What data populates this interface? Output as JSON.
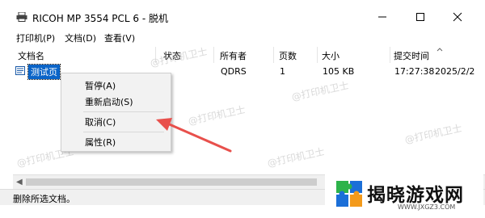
{
  "window": {
    "title": "RICOH MP 3554 PCL 6 - 脱机",
    "minimize_icon": "minimize-icon",
    "maximize_icon": "maximize-icon",
    "close_icon": "close-icon"
  },
  "menu": {
    "items": [
      "打印机(P)",
      "文档(D)",
      "查看(V)"
    ]
  },
  "columns": [
    "文档名",
    "状态",
    "所有者",
    "页数",
    "大小",
    "提交时间"
  ],
  "jobs": [
    {
      "name": "测试页",
      "status": "",
      "owner": "QDRS",
      "pages": "1",
      "size": "105 KB",
      "time": "17:27:38",
      "date": "2025/2/2"
    }
  ],
  "context_menu": {
    "items": [
      "暂停(A)",
      "重新启动(S)",
      "取消(C)",
      "属性(R)"
    ]
  },
  "status_bar": {
    "text": "删除所选文档。"
  },
  "watermark_text": "@打印机卫士",
  "brand": {
    "name": "揭晓游戏网",
    "url": "WWW.JXGZ3.COM"
  },
  "colors": {
    "selection": "#0a64c8",
    "arrow": "#e8504c",
    "logo_green": "#2db34a",
    "logo_blue": "#1b6fd8",
    "logo_orange": "#f39a1b"
  }
}
